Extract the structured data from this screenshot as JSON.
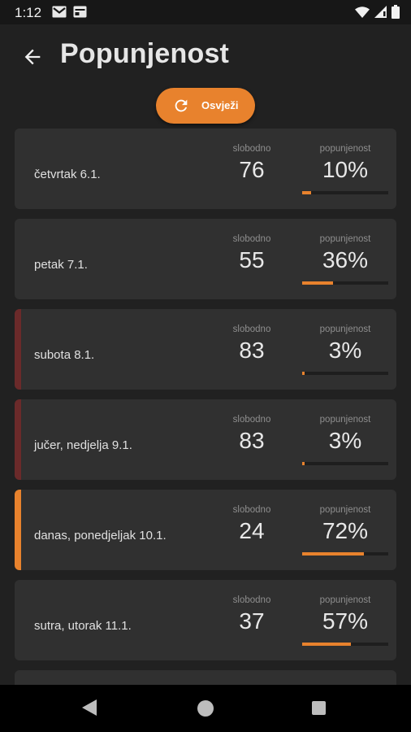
{
  "status_bar": {
    "time": "1:12",
    "icons": [
      "gmail-icon",
      "calendar-icon",
      "wifi-icon",
      "signal-icon",
      "battery-icon"
    ]
  },
  "header": {
    "title": "Popunjenost",
    "back_icon": "arrow-left-icon"
  },
  "refresh_button": {
    "label": "Osvježi",
    "icon": "refresh-icon"
  },
  "colors": {
    "accent": "#e8822d",
    "past_day": "#6b2a2a",
    "card_bg": "#303030",
    "page_bg": "#212121"
  },
  "days": [
    {
      "label": "četvrtak 6.1.",
      "free_caption": "slobodno",
      "free": "76",
      "occ_caption": "popunjenost",
      "occupancy": "10%",
      "occupancy_value": 10,
      "state": "future"
    },
    {
      "label": "petak 7.1.",
      "free_caption": "slobodno",
      "free": "55",
      "occ_caption": "popunjenost",
      "occupancy": "36%",
      "occupancy_value": 36,
      "state": "future"
    },
    {
      "label": "subota 8.1.",
      "free_caption": "slobodno",
      "free": "83",
      "occ_caption": "popunjenost",
      "occupancy": "3%",
      "occupancy_value": 3,
      "state": "past"
    },
    {
      "label": "jučer, nedjelja 9.1.",
      "free_caption": "slobodno",
      "free": "83",
      "occ_caption": "popunjenost",
      "occupancy": "3%",
      "occupancy_value": 3,
      "state": "past"
    },
    {
      "label": "danas, ponedjeljak 10.1.",
      "free_caption": "slobodno",
      "free": "24",
      "occ_caption": "popunjenost",
      "occupancy": "72%",
      "occupancy_value": 72,
      "state": "today"
    },
    {
      "label": "sutra, utorak 11.1.",
      "free_caption": "slobodno",
      "free": "37",
      "occ_caption": "popunjenost",
      "occupancy": "57%",
      "occupancy_value": 57,
      "state": "future"
    }
  ],
  "nav_bar": {
    "icons": [
      "nav-back-icon",
      "nav-home-icon",
      "nav-recents-icon"
    ]
  }
}
